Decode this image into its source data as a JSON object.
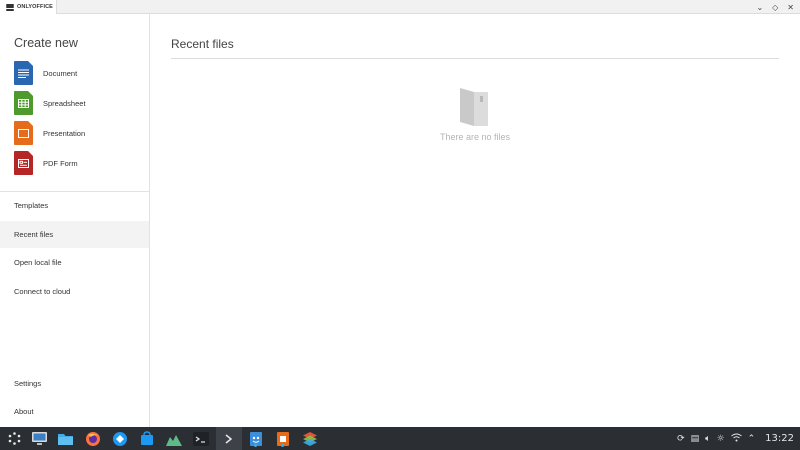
{
  "app": {
    "tab_label": "ONLYOFFICE"
  },
  "window_controls": {
    "minimize": "⌄",
    "restore": "◇",
    "close": "✕"
  },
  "sidebar": {
    "create_title": "Create new",
    "create_items": [
      {
        "label": "Document",
        "icon": "document-icon",
        "color": "#2a67b3"
      },
      {
        "label": "Spreadsheet",
        "icon": "spreadsheet-icon",
        "color": "#4f9a2c"
      },
      {
        "label": "Presentation",
        "icon": "presentation-icon",
        "color": "#e46c1a"
      },
      {
        "label": "PDF Form",
        "icon": "pdf-form-icon",
        "color": "#b52727"
      }
    ],
    "nav": [
      {
        "label": "Templates",
        "active": false
      },
      {
        "label": "Recent files",
        "active": true
      },
      {
        "label": "Open local file",
        "active": false
      },
      {
        "label": "Connect to cloud",
        "active": false
      }
    ],
    "bottom_nav": [
      {
        "label": "Settings"
      },
      {
        "label": "About"
      }
    ]
  },
  "main": {
    "title": "Recent files",
    "empty_text": "There are no files"
  },
  "taskbar": {
    "clock": "13:22",
    "apps": [
      "app-launcher",
      "system-settings",
      "file-manager",
      "firefox",
      "browser",
      "discover-store",
      "system-monitor",
      "terminal",
      "console",
      "onlyoffice",
      "onlyoffice-presentation",
      "onlyoffice-desktop"
    ]
  },
  "colors": {
    "accent": "#3daee9",
    "taskbar_bg": "#2b2e33"
  }
}
